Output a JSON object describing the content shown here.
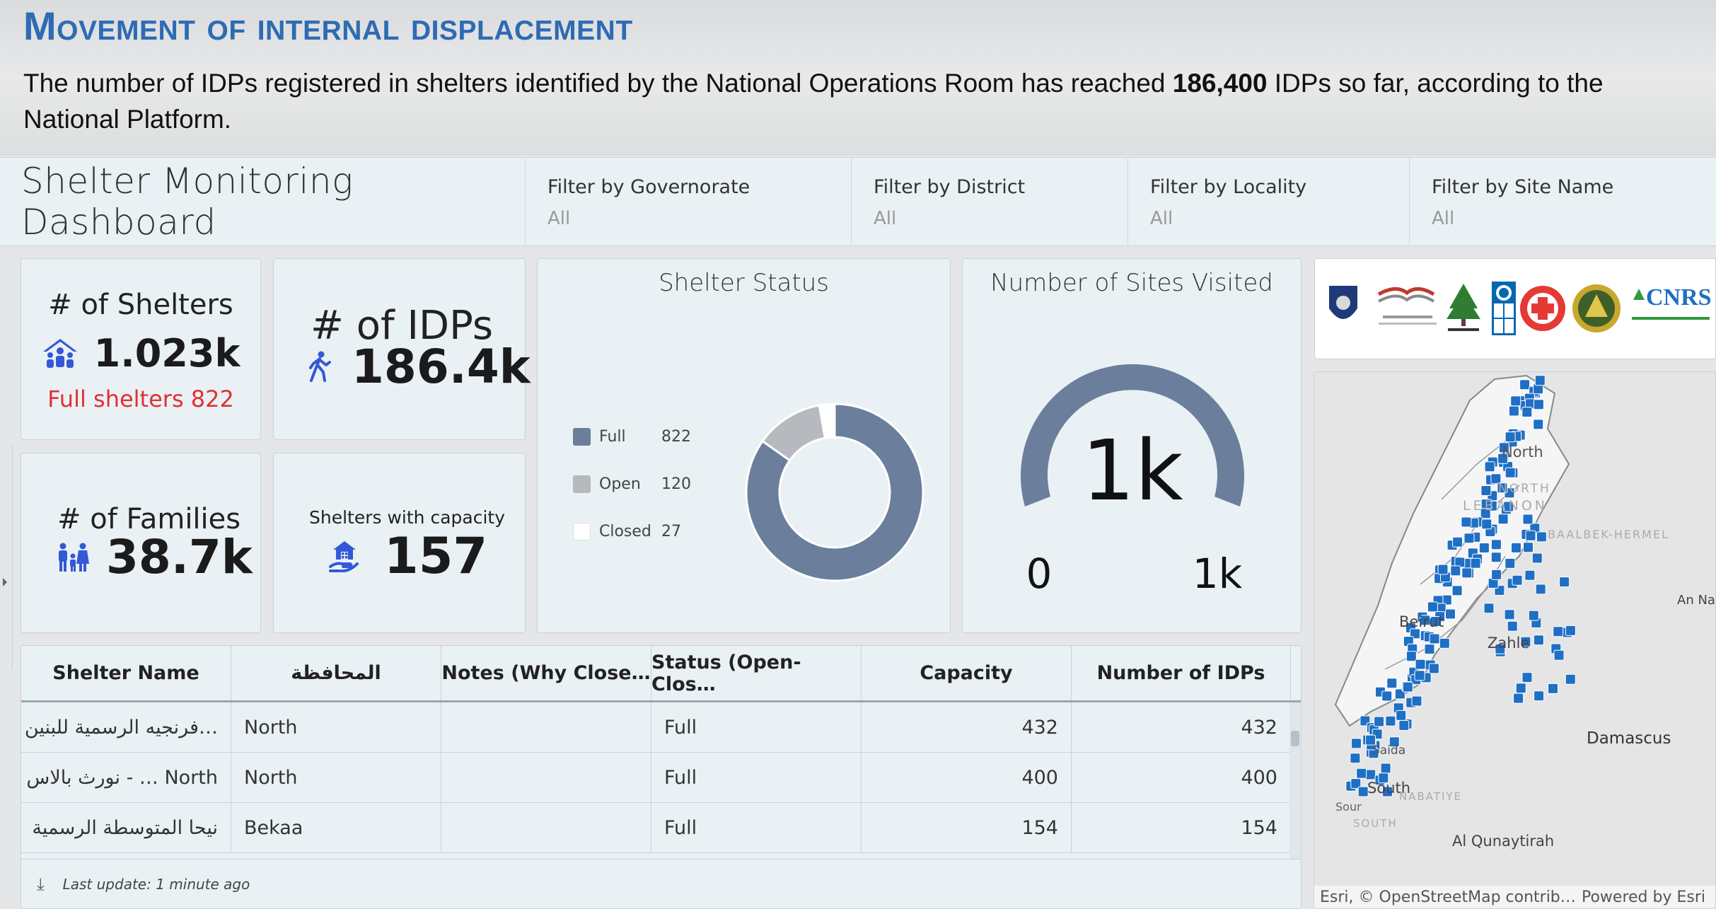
{
  "slide": {
    "title": "Movement of internal displacement",
    "text_before": "The number of IDPs registered in shelters identified by the National Operations Room has reached ",
    "text_bold": "186,400",
    "text_after": " IDPs so far, according to the National Platform."
  },
  "dashboard": {
    "title": "Shelter Monitoring Dashboard",
    "filters": [
      {
        "label": "Filter by Governorate",
        "value": "All"
      },
      {
        "label": "Filter by District",
        "value": "All"
      },
      {
        "label": "Filter by Locality",
        "value": "All"
      },
      {
        "label": "Filter by Site Name",
        "value": "All"
      }
    ]
  },
  "cards": {
    "shelters": {
      "title": "# of Shelters",
      "value": "1.023k",
      "full_label": "Full shelters 822",
      "icon": "people-shelter-icon"
    },
    "idps": {
      "title": "# of IDPs",
      "value": "186.4k",
      "icon": "person-walking-icon"
    },
    "families": {
      "title": "# of Families",
      "value": "38.7k",
      "icon": "family-icon"
    },
    "capacity": {
      "title": "Shelters with capacity",
      "value": "157",
      "icon": "house-hand-icon"
    }
  },
  "shelter_status": {
    "title": "Shelter Status",
    "colors": {
      "Full": "#6b7f9c",
      "Open": "#b6b9bd",
      "Closed": "#ffffff"
    }
  },
  "sites_visited": {
    "title": "Number of Sites Visited",
    "value_label": "1k",
    "min_label": "0",
    "max_label": "1k",
    "color": "#6b7f9c"
  },
  "chart_data": [
    {
      "type": "pie",
      "title": "Shelter Status",
      "categories": [
        "Full",
        "Open",
        "Closed"
      ],
      "values": [
        822,
        120,
        27
      ]
    }
  ],
  "map": {
    "labels": [
      "North",
      "NORTH",
      "LEBANON",
      "BAALBEK-HERMEL",
      "Beirut",
      "Zahle",
      "An Na",
      "Damascus",
      "Saida",
      "South",
      "Sour",
      "SOUTH",
      "NABATIYE",
      "Al Qunaytirah"
    ],
    "attribution": "Esri, © OpenStreetMap contrib…",
    "powered": "Powered by Esri"
  },
  "table": {
    "headers": [
      "Shelter Name",
      "المحافظة",
      "Notes (Why Close…",
      "Status (Open-Clos…",
      "Capacity",
      "Number of IDPs"
    ],
    "rows": [
      [
        "…فرنجيه الرسمية للبنين",
        "North",
        "",
        "Full",
        "432",
        "432"
      ],
      [
        "North … - نورث بالاس",
        "North",
        "",
        "Full",
        "400",
        "400"
      ],
      [
        "نيحا المتوسطة الرسمية",
        "Bekaa",
        "",
        "Full",
        "154",
        "154"
      ]
    ],
    "footer": "Last update: 1 minute ago"
  }
}
